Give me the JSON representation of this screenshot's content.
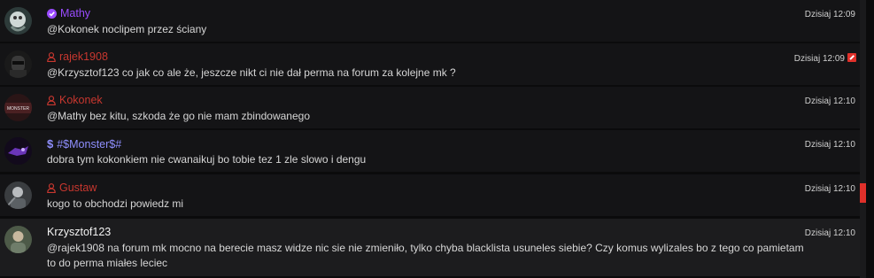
{
  "colors": {
    "vip_purple": "#9a4bff",
    "mod_red": "#c8372f",
    "monster_blue": "#8f8fff",
    "default_name": "#f2f2f2",
    "scroll_thumb": "#e0302a"
  },
  "messages": [
    {
      "user": "Mathy",
      "badge_icon": "checkmark-badge-icon",
      "text": "@Kokonek noclipem przez ściany",
      "time": "Dzisiaj 12:09"
    },
    {
      "user": "rajek1908",
      "badge_icon": "user-outline-icon",
      "text": "@Krzysztof123 co jak co ale że, jeszcze nikt ci nie dał perma na forum za kolejne mk ?",
      "time": "Dzisiaj 12:09",
      "edited": true
    },
    {
      "user": "Kokonek",
      "badge_icon": "user-outline-icon",
      "text": "@Mathy bez kitu, szkoda że go nie mam zbindowanego",
      "time": "Dzisiaj 12:10"
    },
    {
      "user": "#$Monster$#",
      "badge_icon": "dollar-sign-icon",
      "text": "dobra tym kokonkiem nie cwanaikuj bo tobie tez 1 zle slowo i dengu",
      "time": "Dzisiaj 12:10"
    },
    {
      "user": "Gustaw",
      "badge_icon": "user-outline-icon",
      "text": "kogo to obchodzi powiedz mi",
      "time": "Dzisiaj 12:10"
    },
    {
      "user": "Krzysztof123",
      "text": "@rajek1908 na forum mk mocno na berecie masz widze nic sie nie zmieniło, tylko chyba blacklista usuneles siebie? Czy komus wylizales bo z tego co pamietam to do perma miałes leciec",
      "time": "Dzisiaj 12:10"
    }
  ]
}
